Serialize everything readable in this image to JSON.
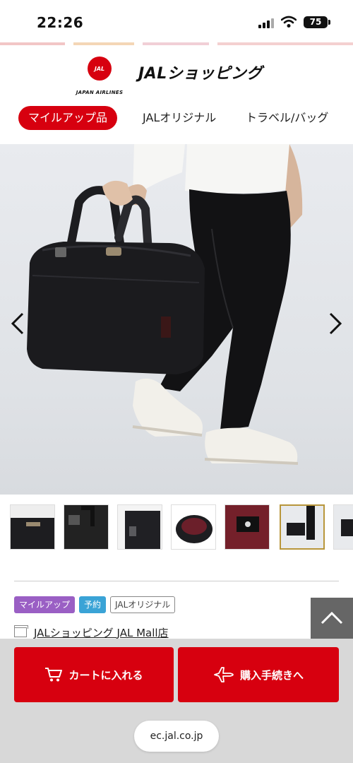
{
  "status_bar": {
    "time": "22:26",
    "battery": "75"
  },
  "header": {
    "crane_text": "JAL",
    "airline_name": "JAPAN AIRLINES",
    "shop_title": "JALショッピング"
  },
  "category_nav": {
    "tabs": [
      {
        "label": "マイルアップ品",
        "active": true
      },
      {
        "label": "JALオリジナル",
        "active": false
      },
      {
        "label": "トラベル/バッグ",
        "active": false
      }
    ]
  },
  "product": {
    "badges": [
      {
        "label": "マイルアップ",
        "color": "#9a5fc4"
      },
      {
        "label": "予約",
        "color": "#3aa3d6"
      },
      {
        "label": "JALオリジナル",
        "color": "#666666"
      }
    ],
    "store_name": "JALショッピング JAL Mall店"
  },
  "actions": {
    "cart_label": "カートに入れる",
    "checkout_label": "購入手続きへ"
  },
  "browser": {
    "url": "ec.jal.co.jp"
  },
  "colors": {
    "brand_red": "#d7000f",
    "thumb_selected": "#b8963b"
  },
  "icons": [
    "signal-icon",
    "wifi-icon",
    "chevron-left-icon",
    "chevron-right-icon",
    "store-icon",
    "chevron-up-icon",
    "cart-icon",
    "airplane-icon"
  ]
}
